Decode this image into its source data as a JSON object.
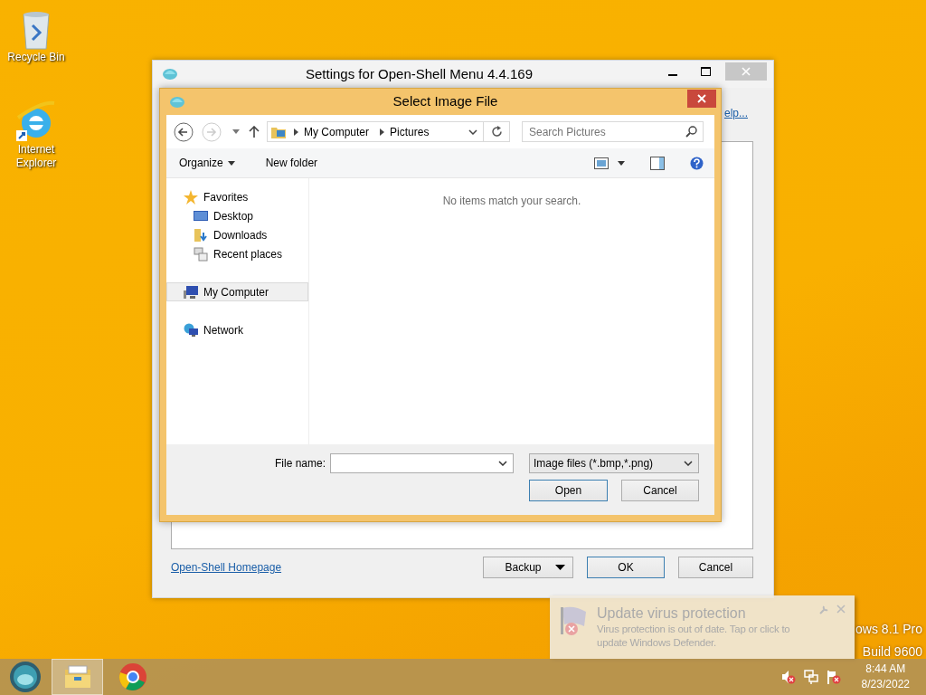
{
  "desktop_icons": [
    {
      "label": "Recycle Bin",
      "kind": "recycle"
    },
    {
      "label": "Internet Explorer",
      "kind": "browser"
    }
  ],
  "settings_window": {
    "title": "Settings for Open-Shell Menu 4.4.169",
    "help_link": "elp...",
    "homepage_link": "Open-Shell Homepage",
    "buttons": [
      {
        "label": "Backup",
        "dropdown": true,
        "default": false
      },
      {
        "label": "OK",
        "dropdown": false,
        "default": true
      },
      {
        "label": "Cancel",
        "dropdown": false,
        "default": false
      }
    ]
  },
  "file_dialog": {
    "title": "Select Image File",
    "breadcrumbs": [
      "My Computer",
      "Pictures"
    ],
    "search": {
      "placeholder": "Search Pictures"
    },
    "toolbar": [
      {
        "label": "Organize",
        "dropdown": true
      },
      {
        "label": "New folder",
        "dropdown": false
      }
    ],
    "nav_items": [
      {
        "label": "Favorites",
        "kind": "star",
        "selected": false,
        "children": [
          {
            "label": "Desktop",
            "kind": "desktop",
            "selected": false
          },
          {
            "label": "Downloads",
            "kind": "downloads",
            "selected": false
          },
          {
            "label": "Recent places",
            "kind": "recent",
            "selected": false
          }
        ]
      },
      {
        "label": "My Computer",
        "kind": "computer",
        "selected": true
      },
      {
        "label": "Network",
        "kind": "network",
        "selected": false
      }
    ],
    "empty_message": "No items match your search.",
    "file_name_label": "File name:",
    "file_type": "Image files (*.bmp,*.png)",
    "buttons": [
      {
        "label": "Open",
        "default": true
      },
      {
        "label": "Cancel",
        "default": false
      }
    ]
  },
  "notification": {
    "title": "Update virus protection",
    "message": "Virus protection is out of date. Tap or click to update Windows Defender."
  },
  "os_watermark": [
    "ows 8.1 Pro",
    "Build 9600"
  ],
  "taskbar": {
    "apps": [
      {
        "kind": "start",
        "selected": false
      },
      {
        "kind": "explorer",
        "selected": true
      },
      {
        "kind": "chrome",
        "selected": false
      }
    ],
    "clock": {
      "time": "8:44 AM",
      "date": "8/23/2022"
    }
  }
}
